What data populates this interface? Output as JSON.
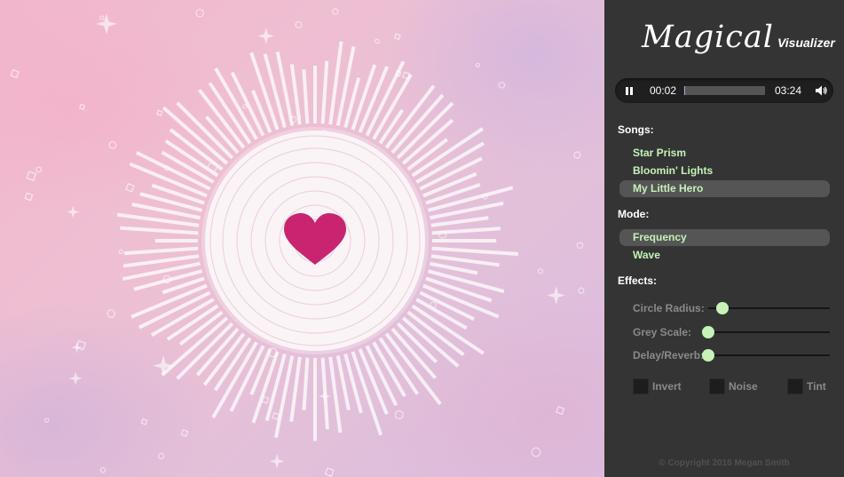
{
  "app": {
    "logo_main": "Magical",
    "logo_sub": "Visualizer"
  },
  "player": {
    "state": "playing",
    "current_time": "00:02",
    "total_time": "03:24",
    "progress_fraction": 0.01
  },
  "songs": {
    "label": "Songs:",
    "items": [
      {
        "label": "Star Prism",
        "active": false
      },
      {
        "label": "Bloomin' Lights",
        "active": false
      },
      {
        "label": "My Little Hero",
        "active": true
      }
    ]
  },
  "mode": {
    "label": "Mode:",
    "items": [
      {
        "label": "Frequency",
        "active": true
      },
      {
        "label": "Wave",
        "active": false
      }
    ]
  },
  "effects": {
    "label": "Effects:",
    "sliders": [
      {
        "label": "Circle Radius:",
        "value": 0.12
      },
      {
        "label": "Grey Scale:",
        "value": 0.0
      },
      {
        "label": "Delay/Reverb:",
        "value": 0.0
      }
    ],
    "checkboxes": [
      {
        "label": "Invert",
        "checked": false
      },
      {
        "label": "Noise",
        "checked": false
      },
      {
        "label": "Tint",
        "checked": false
      }
    ]
  },
  "footer": {
    "copyright": "© Copyright 2016 Megan Smith"
  },
  "colors": {
    "panel_bg": "#343434",
    "option_text": "#c4f2b6",
    "slider_thumb": "#c7f2b8",
    "heart": "#c8246f",
    "bars": "#ffffff"
  }
}
